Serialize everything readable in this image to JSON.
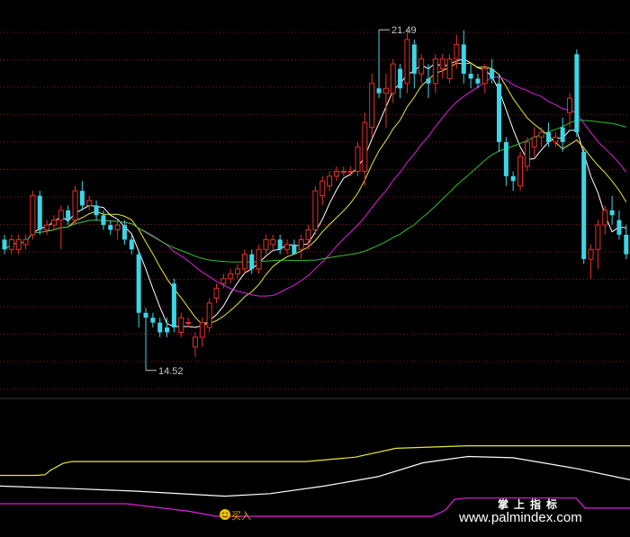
{
  "chart_data": {
    "type": "candlestick",
    "title": "",
    "ylim": [
      14.0,
      22.0
    ],
    "annotations": {
      "max_label": "21.49",
      "min_label": "14.52",
      "signal_label": "买入"
    },
    "watermark": {
      "cn": "掌上指标",
      "url": "www.palmindex.com"
    },
    "colors": {
      "up": "#e8302c",
      "down": "#3ad6e6",
      "ma_short": "#ffffff",
      "ma_mid": "#e8e83a",
      "ma_long": "#e020e0",
      "ma_longest": "#30c030",
      "ind_upper": "#e8e83a",
      "ind_mid": "#ffffff",
      "ind_lower": "#e020e0",
      "grid": "#8a1b1b"
    },
    "candles": [
      [
        17.2,
        17.3,
        16.9,
        17.0
      ],
      [
        17.0,
        17.3,
        16.9,
        17.2
      ],
      [
        17.0,
        17.3,
        16.9,
        17.2
      ],
      [
        17.1,
        17.3,
        17.0,
        17.2
      ],
      [
        17.3,
        18.2,
        17.2,
        18.1
      ],
      [
        18.1,
        18.2,
        17.3,
        17.4
      ],
      [
        17.4,
        17.6,
        17.3,
        17.5
      ],
      [
        17.5,
        17.7,
        17.4,
        17.6
      ],
      [
        17.6,
        17.9,
        17.0,
        17.8
      ],
      [
        17.8,
        17.9,
        17.5,
        17.6
      ],
      [
        17.6,
        18.3,
        17.5,
        18.2
      ],
      [
        18.2,
        18.4,
        17.8,
        17.9
      ],
      [
        17.9,
        18.1,
        17.8,
        18.0
      ],
      [
        17.9,
        18.0,
        17.6,
        17.7
      ],
      [
        17.7,
        17.8,
        17.4,
        17.5
      ],
      [
        17.5,
        17.6,
        17.3,
        17.4
      ],
      [
        17.4,
        17.6,
        17.2,
        17.5
      ],
      [
        17.5,
        17.6,
        17.1,
        17.2
      ],
      [
        17.2,
        17.3,
        16.9,
        17.0
      ],
      [
        16.9,
        17.0,
        15.4,
        15.7
      ],
      [
        15.7,
        15.8,
        14.52,
        15.6
      ],
      [
        15.6,
        15.7,
        15.4,
        15.5
      ],
      [
        15.5,
        15.6,
        15.2,
        15.3
      ],
      [
        15.4,
        15.6,
        15.2,
        15.3
      ],
      [
        16.3,
        16.4,
        15.3,
        15.4
      ],
      [
        15.3,
        15.7,
        15.2,
        15.6
      ],
      [
        15.5,
        15.6,
        15.4,
        15.5
      ],
      [
        15.0,
        15.3,
        14.8,
        15.2
      ],
      [
        15.2,
        15.6,
        15.0,
        15.5
      ],
      [
        15.4,
        16.0,
        15.3,
        15.9
      ],
      [
        16.0,
        16.3,
        15.9,
        16.2
      ],
      [
        16.3,
        16.5,
        16.2,
        16.4
      ],
      [
        16.4,
        16.6,
        16.3,
        16.5
      ],
      [
        16.5,
        16.7,
        16.4,
        16.6
      ],
      [
        16.6,
        17.0,
        16.5,
        16.9
      ],
      [
        16.9,
        17.0,
        16.5,
        16.6
      ],
      [
        16.6,
        17.1,
        16.5,
        17.0
      ],
      [
        17.0,
        17.3,
        16.9,
        17.2
      ],
      [
        17.1,
        17.3,
        17.0,
        17.2
      ],
      [
        17.2,
        17.3,
        16.9,
        17.0
      ],
      [
        17.0,
        17.2,
        16.9,
        17.1
      ],
      [
        17.1,
        17.2,
        16.9,
        16.9
      ],
      [
        17.0,
        17.3,
        16.8,
        17.2
      ],
      [
        17.2,
        17.5,
        17.0,
        17.4
      ],
      [
        17.4,
        18.3,
        17.3,
        18.2
      ],
      [
        18.1,
        18.5,
        17.9,
        18.4
      ],
      [
        18.3,
        18.6,
        18.2,
        18.5
      ],
      [
        18.5,
        18.7,
        18.4,
        18.6
      ],
      [
        18.6,
        18.7,
        18.5,
        18.6
      ],
      [
        18.6,
        18.7,
        18.5,
        18.6
      ],
      [
        18.6,
        19.2,
        18.5,
        19.1
      ],
      [
        18.6,
        19.8,
        18.3,
        19.6
      ],
      [
        19.5,
        20.6,
        19.3,
        20.4
      ],
      [
        20.3,
        21.5,
        20.1,
        20.2
      ],
      [
        20.2,
        20.6,
        19.5,
        20.3
      ],
      [
        20.2,
        20.9,
        20.0,
        20.8
      ],
      [
        20.7,
        20.8,
        20.1,
        20.3
      ],
      [
        20.4,
        21.5,
        20.2,
        21.3
      ],
      [
        21.2,
        21.3,
        20.3,
        20.6
      ],
      [
        20.6,
        21.0,
        20.4,
        20.9
      ],
      [
        20.5,
        20.8,
        20.1,
        20.4
      ],
      [
        20.4,
        21.0,
        20.2,
        20.9
      ],
      [
        20.7,
        21.0,
        20.5,
        20.9
      ],
      [
        20.5,
        21.0,
        20.4,
        20.9
      ],
      [
        20.9,
        21.4,
        20.7,
        21.2
      ],
      [
        21.2,
        21.49,
        20.4,
        20.6
      ],
      [
        20.6,
        20.8,
        20.3,
        20.5
      ],
      [
        20.5,
        20.6,
        20.3,
        20.4
      ],
      [
        20.4,
        20.8,
        20.2,
        20.7
      ],
      [
        20.7,
        20.9,
        20.4,
        20.5
      ],
      [
        20.4,
        20.6,
        19.0,
        19.2
      ],
      [
        19.2,
        19.3,
        18.3,
        18.5
      ],
      [
        18.5,
        18.6,
        18.2,
        18.4
      ],
      [
        18.3,
        19.0,
        18.2,
        18.9
      ],
      [
        18.7,
        19.3,
        18.6,
        19.2
      ],
      [
        19.1,
        19.5,
        18.9,
        19.3
      ],
      [
        19.3,
        19.5,
        19.1,
        19.4
      ],
      [
        19.4,
        19.6,
        19.1,
        19.2
      ],
      [
        19.2,
        19.4,
        19.1,
        19.3
      ],
      [
        19.5,
        19.7,
        19.0,
        19.2
      ],
      [
        19.8,
        20.2,
        19.5,
        20.1
      ],
      [
        21.0,
        21.1,
        19.3,
        19.4
      ],
      [
        19.0,
        19.1,
        16.7,
        16.8
      ],
      [
        16.8,
        17.1,
        16.4,
        17.0
      ],
      [
        17.0,
        17.6,
        16.6,
        17.5
      ],
      [
        17.5,
        17.9,
        17.3,
        17.8
      ],
      [
        17.8,
        18.1,
        17.5,
        17.7
      ],
      [
        17.6,
        17.8,
        17.2,
        17.3
      ],
      [
        17.3,
        17.5,
        16.8,
        16.9
      ]
    ],
    "indicator": {
      "ylim": [
        0,
        1
      ],
      "upper": [
        [
          0,
          0.45
        ],
        [
          40,
          0.45
        ],
        [
          50,
          0.46
        ],
        [
          56,
          0.53
        ],
        [
          70,
          0.64
        ],
        [
          80,
          0.67
        ],
        [
          130,
          0.67
        ],
        [
          190,
          0.67
        ],
        [
          253,
          0.67
        ],
        [
          300,
          0.67
        ],
        [
          340,
          0.67
        ],
        [
          395,
          0.74
        ],
        [
          440,
          0.88
        ],
        [
          520,
          0.92
        ],
        [
          600,
          0.92
        ],
        [
          700,
          0.92
        ]
      ],
      "mid": [
        [
          0,
          0.28
        ],
        [
          80,
          0.24
        ],
        [
          150,
          0.2
        ],
        [
          250,
          0.12
        ],
        [
          300,
          0.16
        ],
        [
          360,
          0.28
        ],
        [
          420,
          0.43
        ],
        [
          470,
          0.65
        ],
        [
          520,
          0.75
        ],
        [
          570,
          0.73
        ],
        [
          640,
          0.56
        ],
        [
          700,
          0.38
        ]
      ],
      "lower": [
        [
          0,
          0.0
        ],
        [
          40,
          0.0
        ],
        [
          140,
          0.0
        ],
        [
          210,
          -0.12
        ],
        [
          240,
          -0.2
        ],
        [
          300,
          -0.2
        ],
        [
          360,
          -0.2
        ],
        [
          440,
          -0.2
        ],
        [
          480,
          -0.2
        ],
        [
          495,
          -0.1
        ],
        [
          505,
          0.07
        ],
        [
          520,
          0.09
        ],
        [
          620,
          0.09
        ],
        [
          640,
          0.09
        ],
        [
          650,
          -0.07
        ],
        [
          700,
          -0.07
        ]
      ]
    }
  }
}
